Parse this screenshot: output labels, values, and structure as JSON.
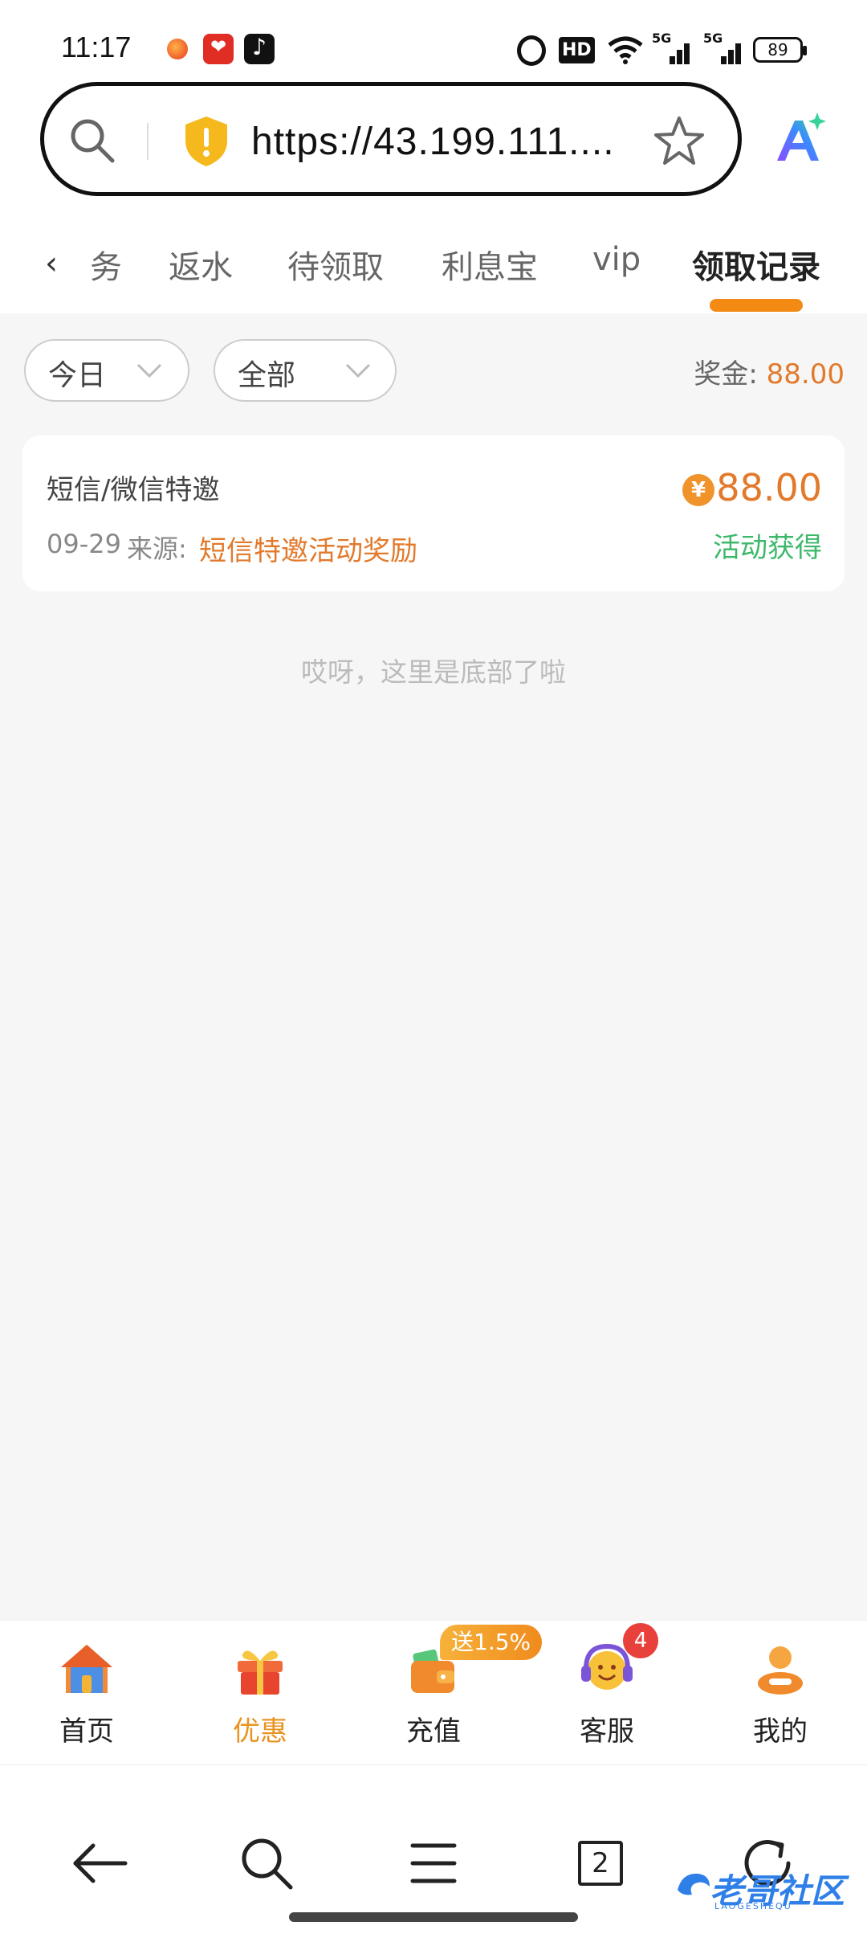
{
  "status_bar": {
    "time": "11:17",
    "hd_label": "HD",
    "signal_label": "5G",
    "battery": "89",
    "icons": [
      "weibo-app-icon",
      "pinduoduo-app-icon",
      "tiktok-app-icon",
      "alarm-icon",
      "hd-icon",
      "wifi-icon",
      "signal-icon",
      "battery-icon"
    ]
  },
  "browser": {
    "url": "https://43.199.111...."
  },
  "tabs": {
    "items": [
      {
        "label": "务",
        "active": false
      },
      {
        "label": "返水",
        "active": false
      },
      {
        "label": "待领取",
        "active": false
      },
      {
        "label": "利息宝",
        "active": false
      },
      {
        "label": "vip",
        "active": false
      },
      {
        "label": "领取记录",
        "active": true
      }
    ]
  },
  "filters": {
    "date": "今日",
    "type": "全部"
  },
  "bonus": {
    "label": "奖金:",
    "value": "88.00"
  },
  "records": [
    {
      "title": "短信/微信特邀",
      "date": "09-29",
      "source_label": "来源:",
      "source": "短信特邀活动奖励",
      "currency_symbol": "¥",
      "amount": "88.00",
      "status": "活动获得"
    }
  ],
  "bottom_note": "哎呀，这里是底部了啦",
  "app_nav": {
    "items": [
      {
        "label": "首页",
        "icon": "home-icon"
      },
      {
        "label": "优惠",
        "icon": "gift-icon",
        "active": true
      },
      {
        "label": "充值",
        "icon": "wallet-icon"
      },
      {
        "label": "客服",
        "icon": "headset-icon"
      },
      {
        "label": "我的",
        "icon": "user-icon"
      }
    ],
    "promo_badge": "送1.5%",
    "service_badge": "4"
  },
  "system_bar": {
    "tab_count": "2"
  },
  "watermark": {
    "text": "老哥社区",
    "sub": "LAOGESHEQU"
  },
  "colors": {
    "accent": "#f28a14",
    "amount": "#e2792b",
    "success": "#3db86b"
  }
}
